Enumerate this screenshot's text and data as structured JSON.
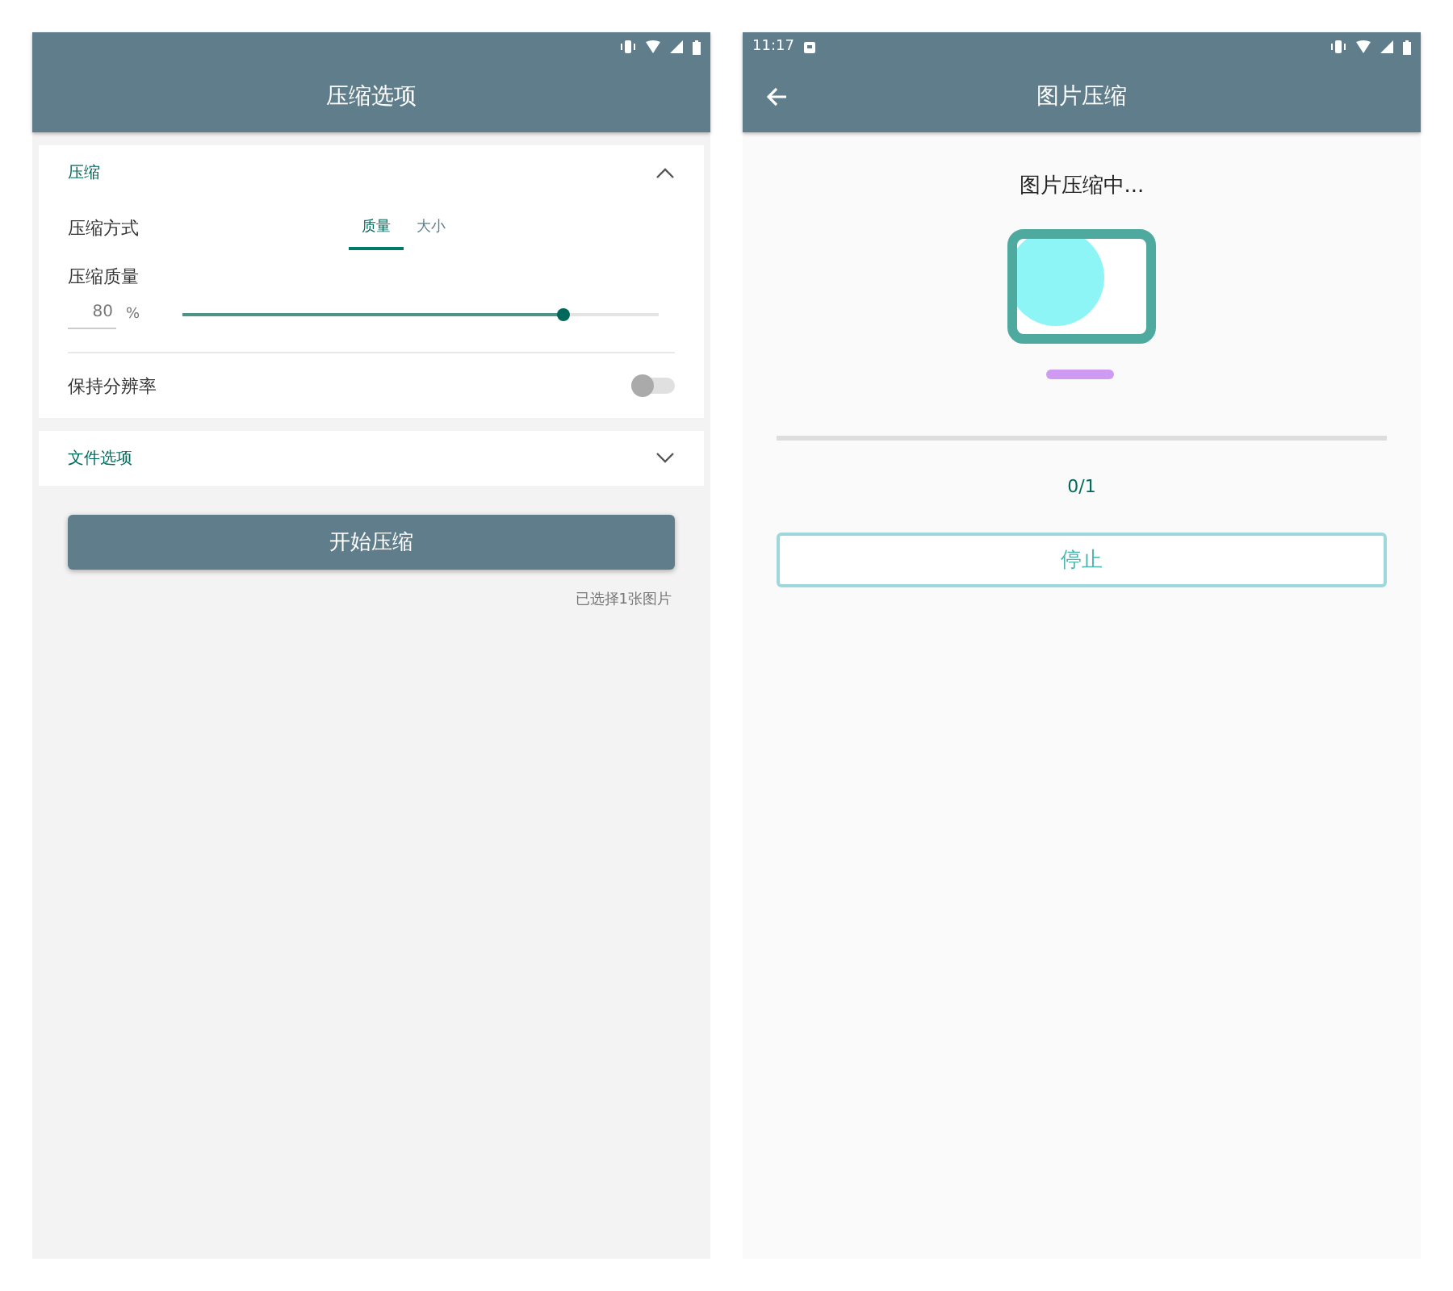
{
  "left_screen": {
    "title": "压缩选项",
    "sections": [
      {
        "title": "压缩",
        "expanded": true
      },
      {
        "title": "文件选项",
        "expanded": false
      }
    ],
    "method": {
      "label": "压缩方式",
      "tabs": [
        {
          "label": "质量",
          "selected": true
        },
        {
          "label": "大小",
          "selected": false
        }
      ]
    },
    "quality": {
      "label": "压缩质量",
      "value": "80",
      "unit": "%",
      "level": 0.8
    },
    "keep_resolution": {
      "label": "保持分辨率",
      "on": false
    },
    "start_button": "开始压缩",
    "selection_note": "已选择1张图片"
  },
  "right_screen": {
    "time": "11:17",
    "title": "图片压缩",
    "status": "图片压缩中...",
    "progress": {
      "level": 0
    },
    "count": "0/1",
    "stop_button": "停止"
  }
}
